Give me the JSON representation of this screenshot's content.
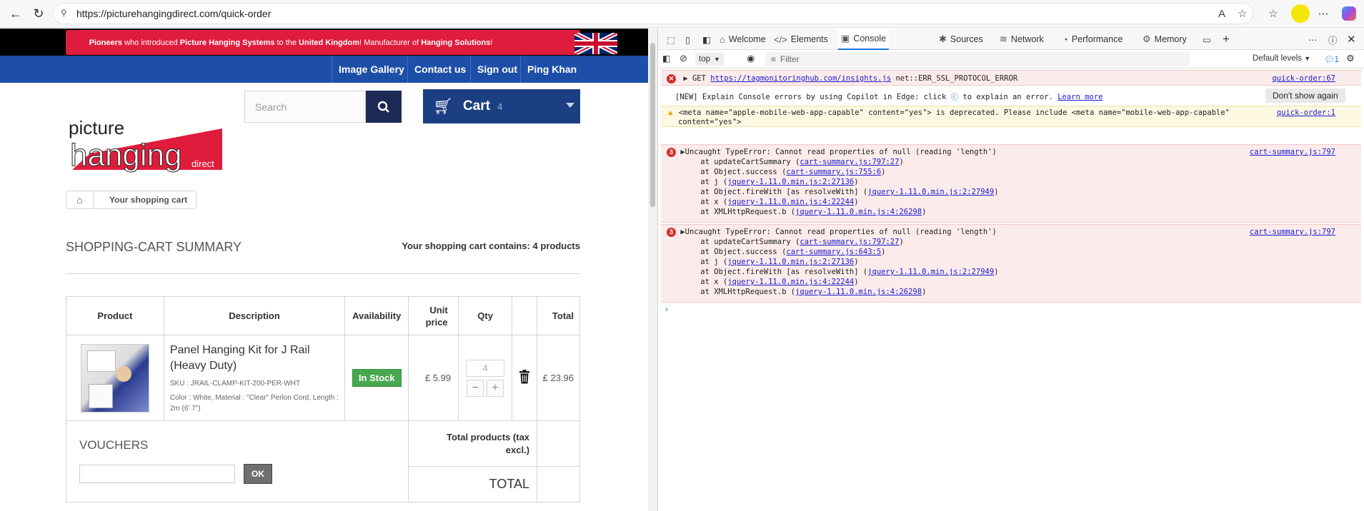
{
  "browser": {
    "url": "https://picturehangingdirect.com/quick-order"
  },
  "site": {
    "promo": {
      "pioneers": "Pioneers",
      "t1": " who introduced ",
      "b1": "Picture Hanging Systems",
      "t2": " to the ",
      "b2": "United Kingdom",
      "t3": "! Manufacturer of ",
      "b3": "Hanging Solutions",
      "t4": "!"
    },
    "nav": [
      "Image Gallery",
      "Contact us",
      "Sign out",
      "Ping Khan"
    ],
    "search_placeholder": "Search",
    "cart_label": "Cart",
    "cart_count": "4",
    "logo": {
      "line1": "picture",
      "line2": "hanging",
      "line3": "direct"
    },
    "breadcrumb": "Your shopping cart",
    "summary_title": "SHOPPING-CART SUMMARY",
    "cart_contains": "Your shopping cart contains: 4 products",
    "table": {
      "headers": [
        "Product",
        "Description",
        "Availability",
        "Unit price",
        "Qty",
        "",
        "Total"
      ],
      "row": {
        "name": "Panel Hanging Kit for J Rail (Heavy Duty)",
        "sku": "SKU : JRAIL-CLAMP-KIT-200-PER-WHT",
        "attrs": "Color : White, Material : \"Clear\" Perlon Cord, Length : 2m (6' 7\")",
        "availability": "In Stock",
        "unit_price": "£ 5.99",
        "qty": "4",
        "total": "£ 23.96"
      },
      "vouchers": "VOUCHERS",
      "ok": "OK",
      "total_products": "Total products (tax excl.)",
      "total": "TOTAL"
    }
  },
  "devtools": {
    "tabs": [
      "Welcome",
      "Elements",
      "Console",
      "Sources",
      "Network",
      "Performance",
      "Memory"
    ],
    "context": "top",
    "filter_placeholder": "Filter",
    "levels": "Default levels",
    "issues_count": "1",
    "messages": {
      "net_error": {
        "prefix": "GET ",
        "url": "https://tagmonitoringhub.com/insights.js",
        "suffix": " net::ERR_SSL_PROTOCOL_ERROR",
        "source": "quick-order:67"
      },
      "copilot": {
        "text1": "[NEW] Explain Console errors by using Copilot in Edge: click ",
        "text2": " to explain an error. ",
        "learn": "Learn more",
        "dismiss": "Don't show again"
      },
      "warn": {
        "line1": "<meta name=\"apple-mobile-web-app-capable\" content=\"yes\"> is deprecated. Please include <meta name=\"mobile-web-app-capable\"",
        "line2": "content=\"yes\">",
        "source": "quick-order:1"
      },
      "error1": {
        "count": "3",
        "head": "Uncaught TypeError: Cannot read properties of null (reading 'length')",
        "source": "cart-summary.js:797",
        "frames": [
          {
            "pre": "    at updateCartSummary (",
            "link": "cart-summary.js:797:27",
            "post": ")"
          },
          {
            "pre": "    at Object.success (",
            "link": "cart-summary.js:755:6",
            "post": ")"
          },
          {
            "pre": "    at j (",
            "link": "jquery-1.11.0.min.js:2:27136",
            "post": ")"
          },
          {
            "pre": "    at Object.fireWith [as resolveWith] (",
            "link": "jquery-1.11.0.min.js:2:27949",
            "post": ")"
          },
          {
            "pre": "    at x (",
            "link": "jquery-1.11.0.min.js:4:22244",
            "post": ")"
          },
          {
            "pre": "    at XMLHttpRequest.b (",
            "link": "jquery-1.11.0.min.js:4:26298",
            "post": ")"
          }
        ]
      },
      "error2": {
        "count": "3",
        "head": "Uncaught TypeError: Cannot read properties of null (reading 'length')",
        "source": "cart-summary.js:797",
        "frames": [
          {
            "pre": "    at updateCartSummary (",
            "link": "cart-summary.js:797:27",
            "post": ")"
          },
          {
            "pre": "    at Object.success (",
            "link": "cart-summary.js:643:5",
            "post": ")"
          },
          {
            "pre": "    at j (",
            "link": "jquery-1.11.0.min.js:2:27136",
            "post": ")"
          },
          {
            "pre": "    at Object.fireWith [as resolveWith] (",
            "link": "jquery-1.11.0.min.js:2:27949",
            "post": ")"
          },
          {
            "pre": "    at x (",
            "link": "jquery-1.11.0.min.js:4:22244",
            "post": ")"
          },
          {
            "pre": "    at XMLHttpRequest.b (",
            "link": "jquery-1.11.0.min.js:4:26298",
            "post": ")"
          }
        ]
      }
    }
  }
}
